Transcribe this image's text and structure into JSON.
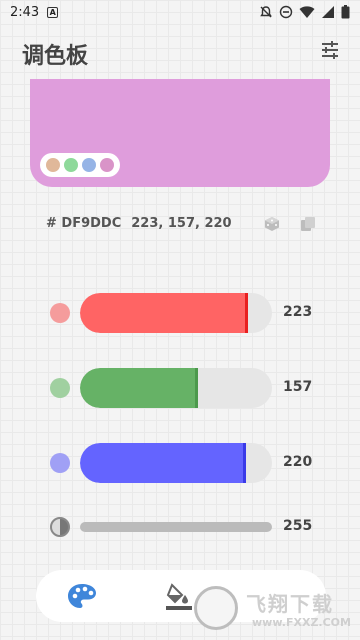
{
  "status_bar": {
    "time": "2:43",
    "a_icon": "A"
  },
  "header": {
    "title": "调色板"
  },
  "preview": {
    "color": "#DF9DDC",
    "swatches": [
      "#E0B89A",
      "#8ED99A",
      "#96B4E6",
      "#D994C8"
    ]
  },
  "color_info": {
    "hex": "# DF9DDC",
    "rgb": "223, 157, 220"
  },
  "sliders": [
    {
      "name": "red",
      "value": "223",
      "fraction": 0.8745,
      "fill": "#FF6464",
      "thumb": "#E82020",
      "dot": "#F59C9C"
    },
    {
      "name": "green",
      "value": "157",
      "fraction": 0.6157,
      "fill": "#66B266",
      "thumb": "#4C994C",
      "dot": "#A0D0A0"
    },
    {
      "name": "blue",
      "value": "220",
      "fraction": 0.8627,
      "fill": "#6464FF",
      "thumb": "#3A3AE8",
      "dot": "#A0A0F5"
    }
  ],
  "alpha": {
    "value": "255"
  },
  "watermark": {
    "title": "飞翔下载",
    "url": "www.FXXZ.COM"
  }
}
